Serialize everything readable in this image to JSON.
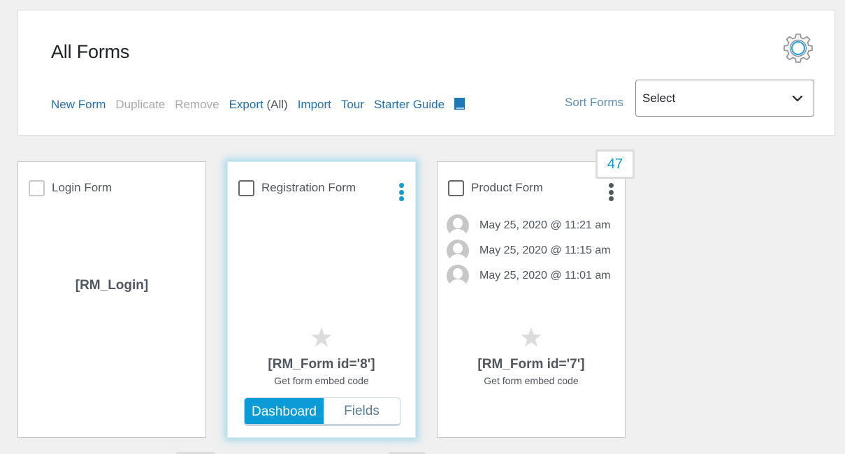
{
  "header": {
    "title": "All Forms",
    "actions": {
      "new_form": "New Form",
      "duplicate": "Duplicate",
      "remove": "Remove",
      "export": "Export",
      "export_scope": "(All)",
      "import": "Import",
      "tour": "Tour",
      "starter_guide": "Starter Guide"
    },
    "sort": {
      "label": "Sort Forms",
      "selected": "Select"
    }
  },
  "colors": {
    "link": "#2271b1",
    "accent": "#0b9bd6",
    "disabled": "#a7aaad"
  },
  "cards": [
    {
      "title": "Login Form",
      "shortcode": "[RM_Login]",
      "checked": false
    },
    {
      "title": "Registration Form",
      "shortcode": "[RM_Form id='8']",
      "embed_hint": "Get form embed code",
      "starred": false,
      "buttons": {
        "dashboard": "Dashboard",
        "fields": "Fields"
      },
      "active": true
    },
    {
      "title": "Product Form",
      "submission_count": "47",
      "submissions": [
        {
          "date": "May 25, 2020 @ 11:21 am"
        },
        {
          "date": "May 25, 2020 @ 11:15 am"
        },
        {
          "date": "May 25, 2020 @ 11:01 am"
        }
      ],
      "shortcode": "[RM_Form id='7']",
      "embed_hint": "Get form embed code",
      "starred": false
    }
  ]
}
